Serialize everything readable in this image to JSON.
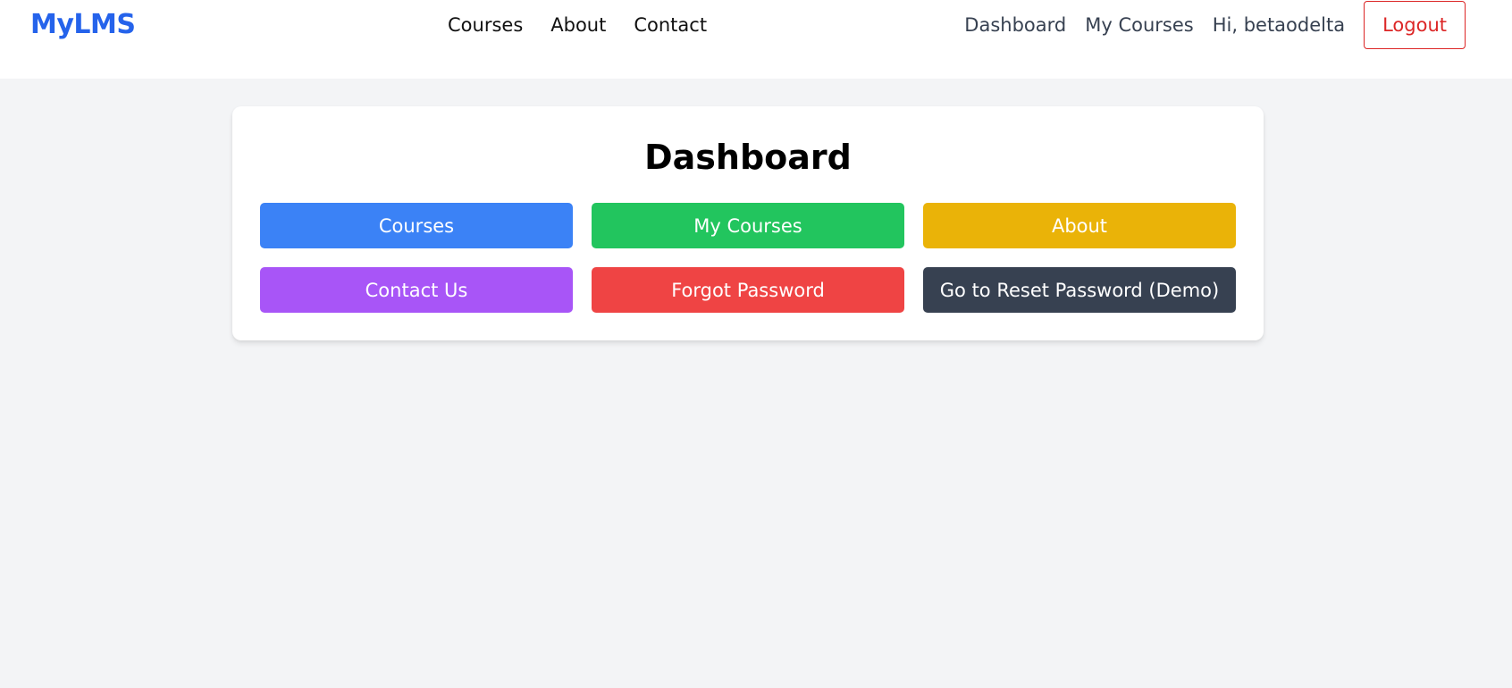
{
  "navbar": {
    "brand": "MyLMS",
    "center_links": [
      "Courses",
      "About",
      "Contact"
    ],
    "dashboard_link": "Dashboard",
    "my_courses_link": "My Courses",
    "greeting": "Hi, betaodelta",
    "logout_label": "Logout"
  },
  "main": {
    "title": "Dashboard",
    "buttons": [
      {
        "label": "Courses",
        "color": "#3b82f6"
      },
      {
        "label": "My Courses",
        "color": "#22c55e"
      },
      {
        "label": "About",
        "color": "#eab308"
      },
      {
        "label": "Contact Us",
        "color": "#a855f7"
      },
      {
        "label": "Forgot Password",
        "color": "#ef4444"
      },
      {
        "label": "Go to Reset Password (Demo)",
        "color": "#374151"
      }
    ]
  },
  "colors": {
    "brand": "#2563eb",
    "background": "#f3f4f6",
    "logout": "#dc2626"
  }
}
